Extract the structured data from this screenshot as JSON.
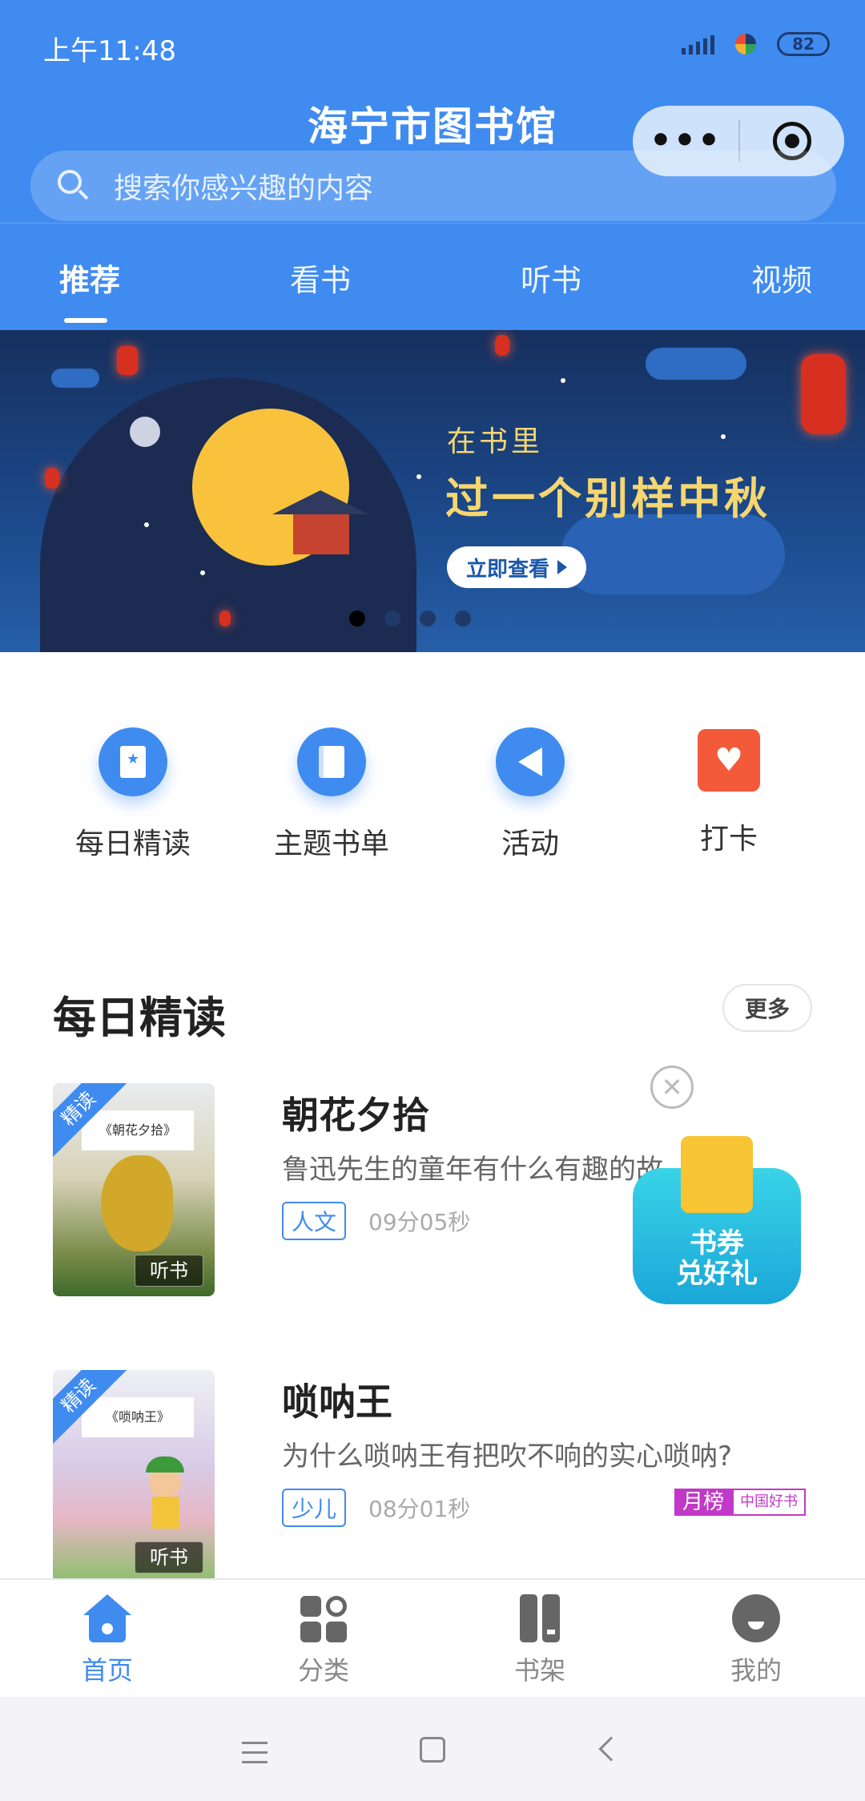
{
  "status_bar": {
    "time": "上午11:48",
    "battery": "82"
  },
  "header": {
    "title": "海宁市图书馆"
  },
  "search": {
    "placeholder": "搜索你感兴趣的内容"
  },
  "tabs": [
    {
      "label": "推荐"
    },
    {
      "label": "看书"
    },
    {
      "label": "听书"
    },
    {
      "label": "视频"
    }
  ],
  "banner": {
    "small_text": "在书里",
    "headline": "过一个别样中秋",
    "button": "立即查看",
    "page_count": 4,
    "active_page": 1
  },
  "quick_entries": [
    {
      "label": "每日精读",
      "icon": "star-book-icon"
    },
    {
      "label": "主题书单",
      "icon": "book-icon"
    },
    {
      "label": "活动",
      "icon": "megaphone-icon"
    },
    {
      "label": "打卡",
      "icon": "calendar-heart-icon"
    }
  ],
  "section": {
    "title": "每日精读",
    "more": "更多"
  },
  "books": [
    {
      "badge": "精读",
      "cover_title": "《朝花夕拾》",
      "cover_tag": "听书",
      "name": "朝花夕拾",
      "desc": "鲁迅先生的童年有什么有趣的故",
      "category": "人文",
      "duration": "09分05秒"
    },
    {
      "badge": "精读",
      "cover_title": "《唢呐王》",
      "cover_tag": "听书",
      "name": "唢呐王",
      "desc": "为什么唢呐王有把吹不响的实心唢呐?",
      "category": "少儿",
      "duration": "08分01秒",
      "rank": "月榜",
      "rank_source": "中国好书"
    }
  ],
  "coupon": {
    "line1": "书券",
    "line2": "兑好礼"
  },
  "bottom_nav": [
    {
      "label": "首页"
    },
    {
      "label": "分类"
    },
    {
      "label": "书架"
    },
    {
      "label": "我的"
    }
  ],
  "colors": {
    "primary": "#3f8bf0",
    "rank": "#c238c8",
    "coupon": "#1aa7d8"
  }
}
